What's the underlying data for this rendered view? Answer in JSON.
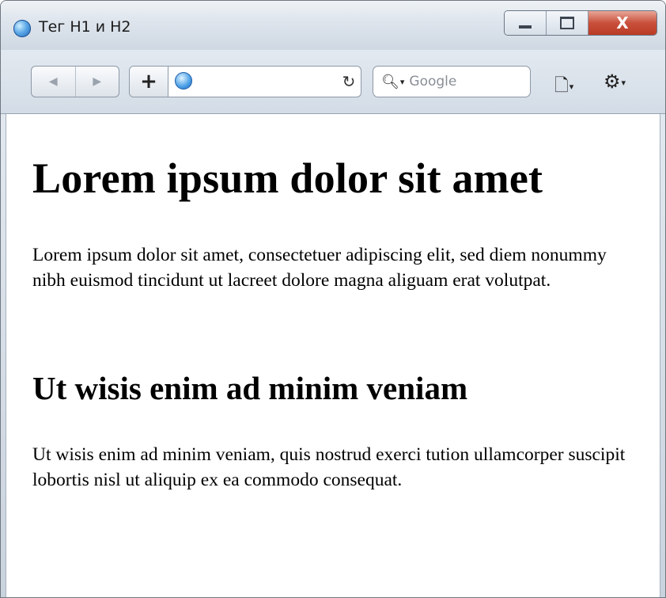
{
  "window": {
    "title": "Тег H1 и H2",
    "caption": {
      "close_label": "X"
    }
  },
  "toolbar": {
    "back_icon": "◀",
    "forward_icon": "▶",
    "add_label": "+",
    "address_value": "",
    "reload_icon": "↻",
    "search_placeholder": "Google",
    "page_menu_icon": "page-icon",
    "tools_menu_icon": "gear-icon"
  },
  "page": {
    "h1": "Lorem ipsum dolor sit amet",
    "p1": "Lorem ipsum dolor sit amet, consectetuer adipiscing elit, sed diem nonummy nibh euismod tincidunt ut lacreet dolore magna aliguam erat volutpat.",
    "h2": "Ut wisis enim ad minim veniam",
    "p2": "Ut wisis enim ad minim veniam, quis nostrud exerci tution ullamcorper suscipit lobortis nisl ut aliquip ex ea commodo consequat."
  },
  "colors": {
    "close_button": "#c9503b",
    "titlebar": "#dde4ec",
    "globe": "#4a9fe6"
  }
}
